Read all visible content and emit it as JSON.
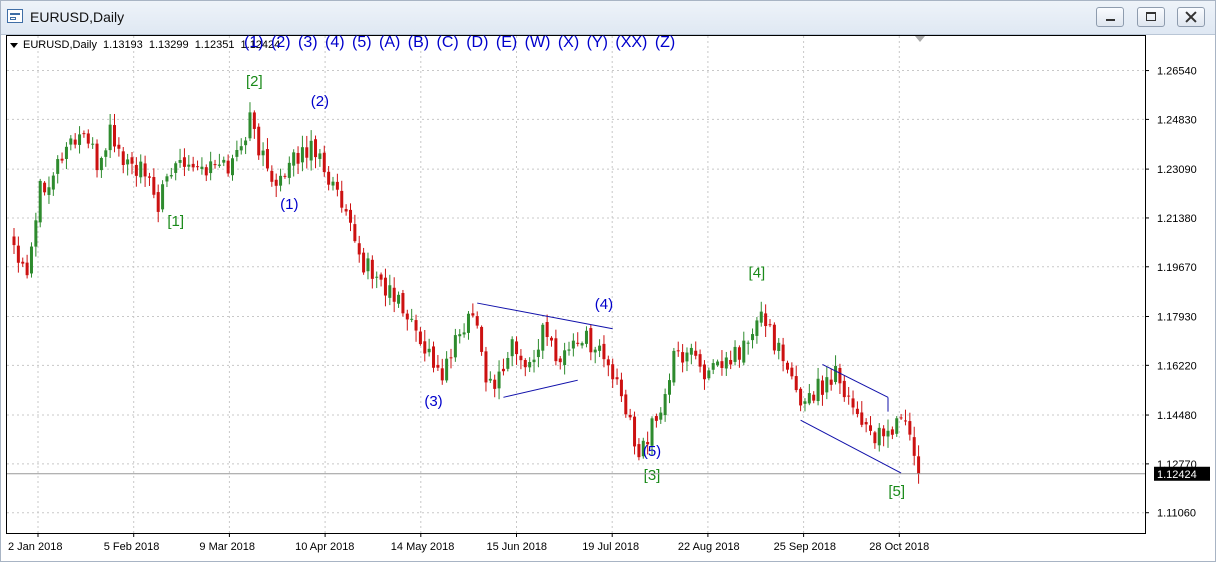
{
  "window": {
    "title": "EURUSD,Daily"
  },
  "info": {
    "symbol": "EURUSD,Daily",
    "open": "1.13193",
    "high": "1.13299",
    "low": "1.12351",
    "close": "1.12424"
  },
  "wave_menu": "(1) (2) (3) (4) (5) (A) (B) (C) (D) (E) (W) (X) (Y) (XX) (Z)",
  "colors": {
    "bull": "#2e8b2e",
    "bear": "#cc1111",
    "minor_wave": "#0000cc",
    "major_wave": "#1a8a1a",
    "grid": "#c8c8c8",
    "price_tag": "#000000"
  },
  "chart_data": {
    "type": "candlestick",
    "symbol": "EURUSD",
    "timeframe": "Daily",
    "ylim": [
      1.1035,
      1.2775
    ],
    "y_ticks": [
      "1.26540",
      "1.24830",
      "1.23090",
      "1.21380",
      "1.19670",
      "1.17930",
      "1.16220",
      "1.14480",
      "1.12770",
      "1.11060"
    ],
    "x_ticks": [
      "2 Jan 2018",
      "5 Feb 2018",
      "9 Mar 2018",
      "10 Apr 2018",
      "14 May 2018",
      "15 Jun 2018",
      "19 Jul 2018",
      "22 Aug 2018",
      "25 Sep 2018",
      "28 Oct 2018"
    ],
    "last_price": "1.12424",
    "grid": true,
    "anchors": [
      {
        "bar": 0,
        "price": 1.205
      },
      {
        "bar": 3,
        "price": 1.196
      },
      {
        "bar": 6,
        "price": 1.225
      },
      {
        "bar": 9,
        "price": 1.23
      },
      {
        "bar": 12,
        "price": 1.239
      },
      {
        "bar": 16,
        "price": 1.244
      },
      {
        "bar": 19,
        "price": 1.232
      },
      {
        "bar": 22,
        "price": 1.244
      },
      {
        "bar": 25,
        "price": 1.234
      },
      {
        "bar": 29,
        "price": 1.23
      },
      {
        "bar": 33,
        "price": 1.219
      },
      {
        "bar": 38,
        "price": 1.236
      },
      {
        "bar": 44,
        "price": 1.231
      },
      {
        "bar": 50,
        "price": 1.233
      },
      {
        "bar": 54,
        "price": 1.248
      },
      {
        "bar": 58,
        "price": 1.23
      },
      {
        "bar": 62,
        "price": 1.227
      },
      {
        "bar": 65,
        "price": 1.236
      },
      {
        "bar": 69,
        "price": 1.239
      },
      {
        "bar": 74,
        "price": 1.221
      },
      {
        "bar": 79,
        "price": 1.2
      },
      {
        "bar": 84,
        "price": 1.191
      },
      {
        "bar": 88,
        "price": 1.184
      },
      {
        "bar": 93,
        "price": 1.172
      },
      {
        "bar": 98,
        "price": 1.158
      },
      {
        "bar": 103,
        "price": 1.177
      },
      {
        "bar": 106,
        "price": 1.18
      },
      {
        "bar": 108,
        "price": 1.156
      },
      {
        "bar": 111,
        "price": 1.158
      },
      {
        "bar": 114,
        "price": 1.17
      },
      {
        "bar": 117,
        "price": 1.16
      },
      {
        "bar": 121,
        "price": 1.173
      },
      {
        "bar": 125,
        "price": 1.165
      },
      {
        "bar": 129,
        "price": 1.172
      },
      {
        "bar": 133,
        "price": 1.17
      },
      {
        "bar": 136,
        "price": 1.162
      },
      {
        "bar": 139,
        "price": 1.15
      },
      {
        "bar": 143,
        "price": 1.133
      },
      {
        "bar": 147,
        "price": 1.142
      },
      {
        "bar": 151,
        "price": 1.164
      },
      {
        "bar": 155,
        "price": 1.168
      },
      {
        "bar": 159,
        "price": 1.158
      },
      {
        "bar": 164,
        "price": 1.164
      },
      {
        "bar": 168,
        "price": 1.17
      },
      {
        "bar": 171,
        "price": 1.179
      },
      {
        "bar": 173,
        "price": 1.176
      },
      {
        "bar": 176,
        "price": 1.162
      },
      {
        "bar": 180,
        "price": 1.15
      },
      {
        "bar": 185,
        "price": 1.155
      },
      {
        "bar": 188,
        "price": 1.161
      },
      {
        "bar": 192,
        "price": 1.148
      },
      {
        "bar": 196,
        "price": 1.139
      },
      {
        "bar": 199,
        "price": 1.135
      },
      {
        "bar": 203,
        "price": 1.145
      },
      {
        "bar": 205,
        "price": 1.138
      },
      {
        "bar": 207,
        "price": 1.1242
      }
    ],
    "labels": [
      {
        "text": "[1]",
        "bar": 37,
        "price": 1.211,
        "level": "major"
      },
      {
        "text": "[2]",
        "bar": 55,
        "price": 1.26,
        "level": "major"
      },
      {
        "text": "(1)",
        "bar": 63,
        "price": 1.217,
        "level": "minor"
      },
      {
        "text": "(2)",
        "bar": 70,
        "price": 1.253,
        "level": "minor"
      },
      {
        "text": "(3)",
        "bar": 96,
        "price": 1.148,
        "level": "minor"
      },
      {
        "text": "(4)",
        "bar": 135,
        "price": 1.182,
        "level": "minor"
      },
      {
        "text": "(5)",
        "bar": 146,
        "price": 1.1305,
        "level": "minor"
      },
      {
        "text": "[3]",
        "bar": 146,
        "price": 1.122,
        "level": "major"
      },
      {
        "text": "[4]",
        "bar": 170,
        "price": 1.193,
        "level": "major"
      },
      {
        "text": "[5]",
        "bar": 202,
        "price": 1.1165,
        "level": "major"
      }
    ],
    "triangle": [
      {
        "from": {
          "bar": 106,
          "price": 1.184
        },
        "to": {
          "bar": 137,
          "price": 1.175
        }
      },
      {
        "from": {
          "bar": 112,
          "price": 1.151
        },
        "to": {
          "bar": 129,
          "price": 1.157
        }
      }
    ],
    "wedge": [
      {
        "from": {
          "bar": 185,
          "price": 1.1625
        },
        "to": {
          "bar": 200,
          "price": 1.151
        }
      },
      {
        "from": {
          "bar": 180,
          "price": 1.143
        },
        "to": {
          "bar": 203,
          "price": 1.1245
        }
      },
      {
        "from": {
          "bar": 200,
          "price": 1.151
        },
        "to": {
          "bar": 200,
          "price": 1.146
        }
      }
    ]
  }
}
